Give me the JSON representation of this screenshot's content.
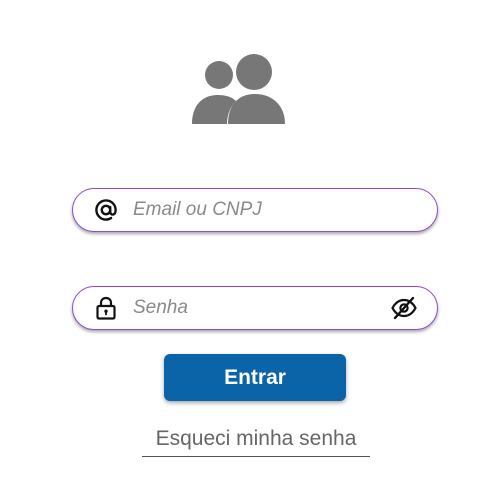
{
  "header": {
    "icon": "users-icon"
  },
  "form": {
    "email": {
      "icon": "at-sign-icon",
      "placeholder": "Email ou CNPJ",
      "value": ""
    },
    "password": {
      "icon": "lock-icon",
      "placeholder": "Senha",
      "value": "",
      "toggle_icon": "eye-off-icon"
    },
    "submit_label": "Entrar",
    "forgot_label": "Esqueci minha senha"
  },
  "colors": {
    "field_border": "#8e4ad6",
    "button_bg": "#0b63a8",
    "icon_gray": "#777777"
  }
}
